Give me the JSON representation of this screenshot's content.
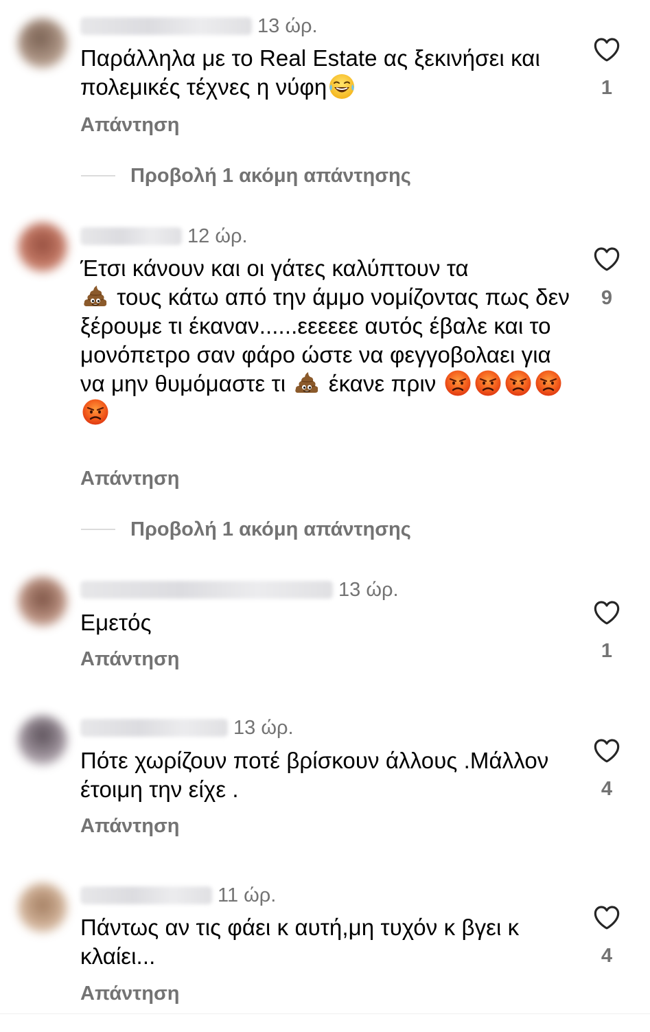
{
  "comments": [
    {
      "time": "13 ώρ.",
      "text_parts": [
        "Παράλληλα με το Real Estate ας ξεκινήσει και πολεμικές τέχνες η νύφη"
      ],
      "reply_label": "Απάντηση",
      "likes": "1",
      "view_more": "Προβολή 1 ακόμη απάντησης"
    },
    {
      "time": "12 ώρ.",
      "text_parts": [
        "Έτσι κάνουν και οι γάτες καλύπτουν τα",
        "τους κάτω από την άμμο νομίζοντας πως δεν ξέρουμε τι έκαναν......εεεεεε αυτός έβαλε και το μονόπετρο σαν φάρο ώστε να φεγγοβολαει για να μην θυμόμαστε τι",
        "έκανε πριν"
      ],
      "reply_label": "Απάντηση",
      "likes": "9",
      "view_more": "Προβολή 1 ακόμη απάντησης"
    },
    {
      "time": "13 ώρ.",
      "text_parts": [
        "Εμετός"
      ],
      "reply_label": "Απάντηση",
      "likes": "1"
    },
    {
      "time": "13 ώρ.",
      "text_parts": [
        "Πότε χωρίζουν ποτέ βρίσκουν άλλους .Μάλλον έτοιμη την είχε ."
      ],
      "reply_label": "Απάντηση",
      "likes": "4"
    },
    {
      "time": "11 ώρ.",
      "text_parts": [
        "Πάντως αν τις φάει κ αυτή,μη τυχόν κ βγει κ κλαίει..."
      ],
      "reply_label": "Απάντηση",
      "likes": "4"
    }
  ],
  "icons": {
    "like": "heart-outline-icon",
    "laughing": "face-with-tears-of-joy-emoji",
    "poop": "pile-of-poo-emoji",
    "angry": "angry-face-emoji"
  },
  "colors": {
    "secondary_text": "#737373",
    "primary_text": "#000000",
    "divider": "#dbdbdb"
  }
}
